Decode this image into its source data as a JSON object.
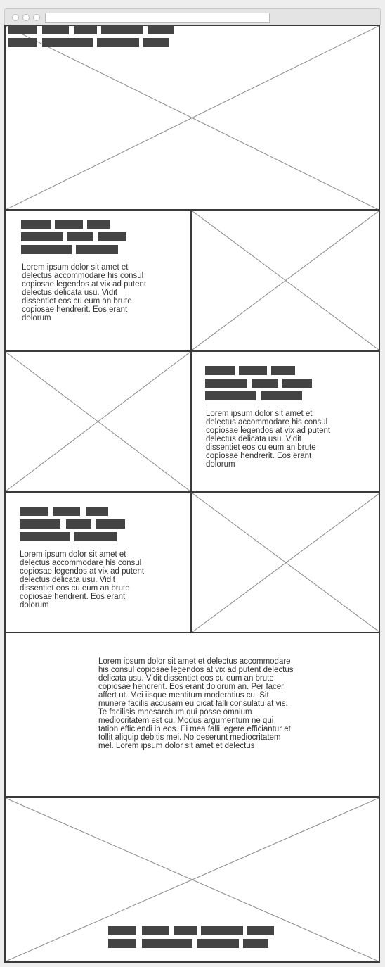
{
  "browser": {
    "address_bar_value": ""
  },
  "hero": {
    "image": "image-placeholder"
  },
  "sections": [
    {
      "body": "Lorem ipsum dolor sit amet et delectus accommodare his consul copiosae legendos at vix ad putent delectus delicata usu. Vidit dissentiet eos cu eum an brute copiosae hendrerit. Eos erant dolorum"
    },
    {
      "body": "Lorem ipsum dolor sit amet et delectus accommodare his consul copiosae legendos at vix ad putent delectus delicata usu. Vidit dissentiet eos cu eum an brute copiosae hendrerit. Eos erant dolorum"
    },
    {
      "body": "Lorem ipsum dolor sit amet et delectus accommodare his consul copiosae legendos at vix ad putent delectus delicata usu. Vidit dissentiet eos cu eum an brute copiosae hendrerit. Eos erant dolorum"
    }
  ],
  "main_text": "Lorem ipsum dolor sit amet et delectus accommodare his consul copiosae legendos at vix ad putent delectus delicata usu. Vidit dissentiet eos cu eum an brute copiosae hendrerit. Eos erant dolorum an. Per facer affert ut. Mei iisque mentitum moderatius cu. Sit munere facilis accusam eu dicat falli consulatu at vis. Te facilisis mnesarchum qui posse omnium mediocritatem est cu. Modus argumentum ne qui tation efficiendi in eos. Ei mea falli legere efficiantur et tollit aliquip debitis mei. No deserunt mediocritatem mel. Lorem ipsum dolor sit amet et delectus",
  "colors": {
    "frame": "#3a3a3a",
    "placeholder_block": "#444444",
    "cross_lines": "#888888",
    "text": "#333333"
  }
}
